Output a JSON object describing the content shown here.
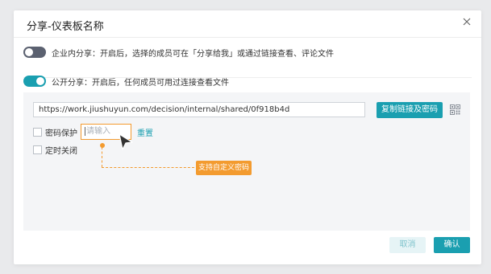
{
  "dialog": {
    "title": "分享-仪表板名称",
    "close_icon": "close-icon"
  },
  "internal_share": {
    "enabled": false,
    "label": "企业内分享：开启后，选择的成员可在「分享给我」或通过链接查看、评论文件"
  },
  "public_share": {
    "enabled": true,
    "label": "公开分享：开启后，任何成员可用过连接查看文件",
    "url": "https://work.jiushuyun.com/decision/internal/shared/0f918b4d",
    "copy_button": "复制链接及密码",
    "qr_icon": "qr-code-icon",
    "password": {
      "checked": false,
      "label": "密码保护",
      "placeholder": "请输入",
      "reset_label": "重置"
    },
    "timed_close": {
      "checked": false,
      "label": "定时关闭"
    },
    "tooltip": "支持自定义密码"
  },
  "footer": {
    "cancel_label": "取消",
    "confirm_label": "确认"
  },
  "colors": {
    "accent": "#1a9fb0",
    "highlight": "#f39b2f"
  }
}
